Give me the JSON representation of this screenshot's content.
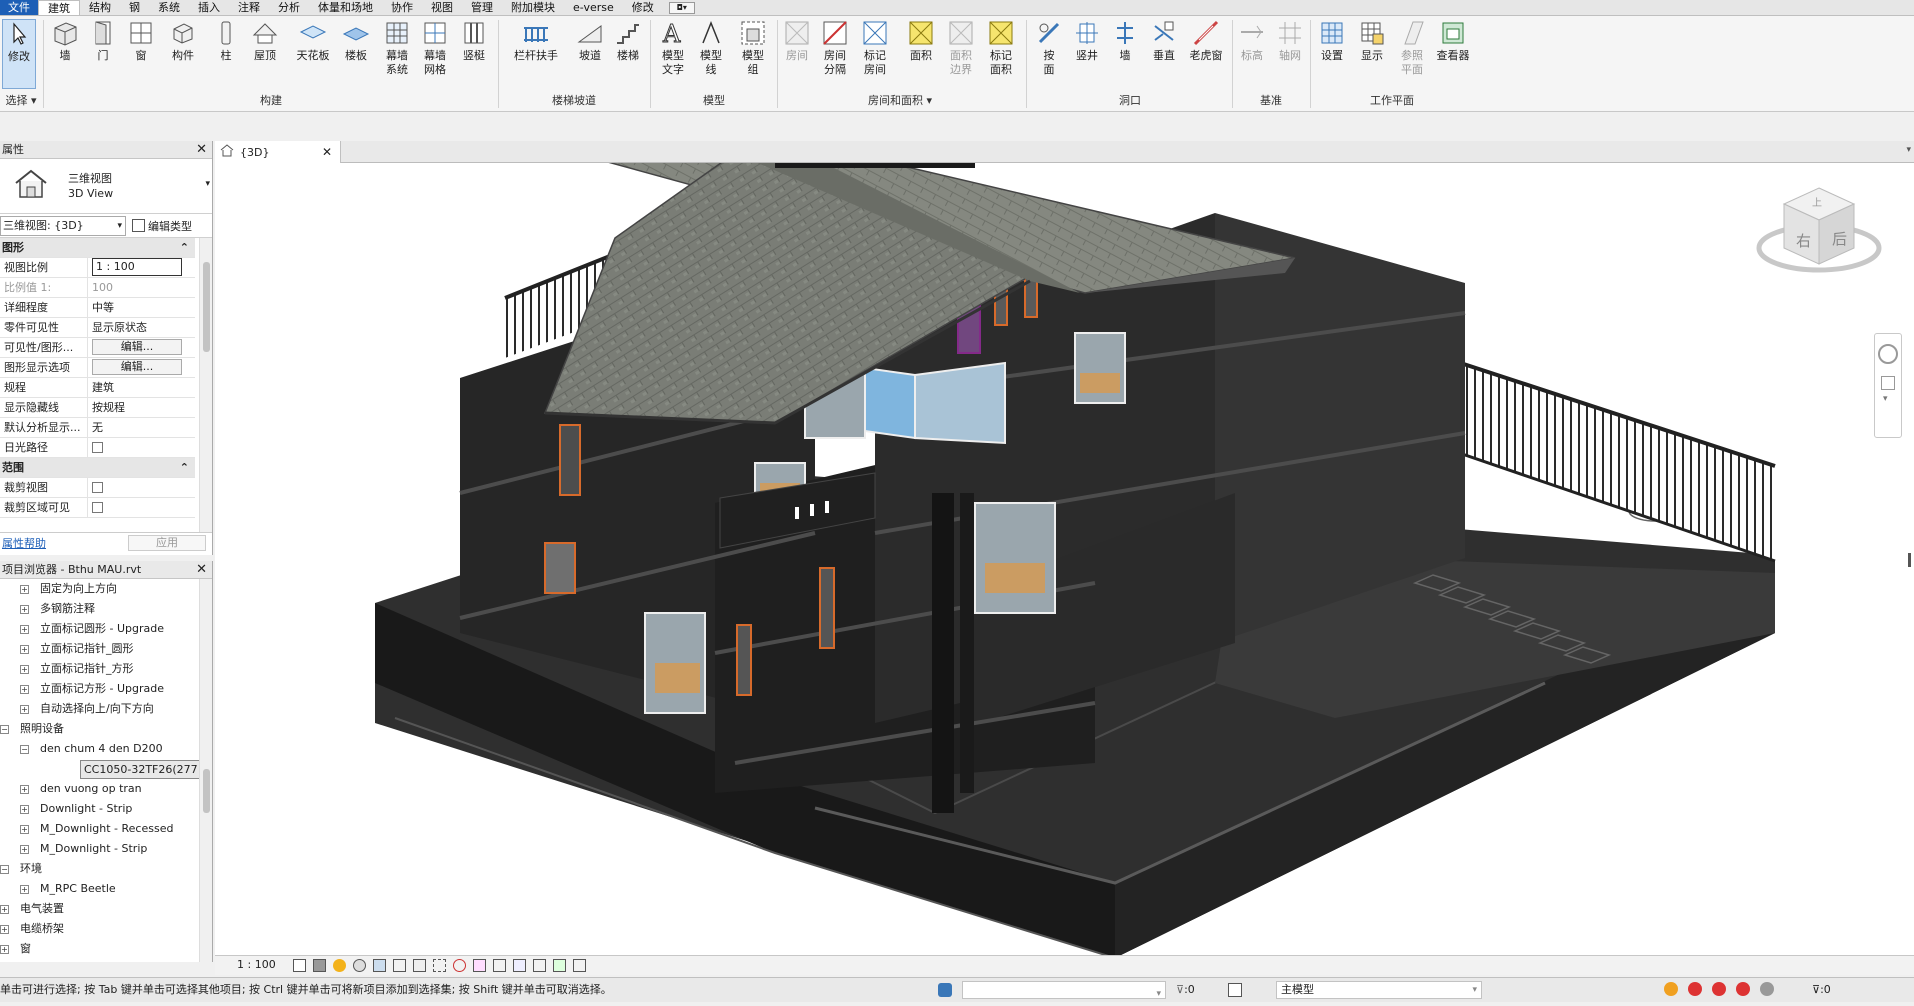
{
  "tabs": [
    "文件",
    "建筑",
    "结构",
    "钢",
    "系统",
    "插入",
    "注释",
    "分析",
    "体量和场地",
    "协作",
    "视图",
    "管理",
    "附加模块",
    "e-verse",
    "修改"
  ],
  "ribbon": {
    "buttons": [
      "修改",
      "墙",
      "门",
      "窗",
      "构件",
      "柱",
      "屋顶",
      "天花板",
      "楼板",
      "幕墙系统",
      "幕墙网格",
      "竖梃",
      "栏杆扶手",
      "坡道",
      "楼梯",
      "模型文字",
      "模型线",
      "模型组",
      "房间",
      "房间分隔",
      "标记房间",
      "面积",
      "面积边界",
      "标记面积",
      "按面",
      "竖井",
      "墙",
      "垂直",
      "老虎窗",
      "标高",
      "轴网",
      "设置",
      "显示",
      "参照平面",
      "查看器"
    ],
    "groups": [
      "选择",
      "构建",
      "楼梯坡道",
      "模型",
      "房间和面积",
      "洞口",
      "基准",
      "工作平面"
    ]
  },
  "properties": {
    "title": "属性",
    "type_name_cn": "三维视图",
    "type_name_en": "3D View",
    "instance_selector": "三维视图: {3D}",
    "edit_type": "编辑类型",
    "cat_graphics": "图形",
    "rows": [
      {
        "k": "视图比例",
        "v": "1 : 100"
      },
      {
        "k": "比例值 1:",
        "v": "100"
      },
      {
        "k": "详细程度",
        "v": "中等"
      },
      {
        "k": "零件可见性",
        "v": "显示原状态"
      },
      {
        "k": "可见性/图形...",
        "v": "编辑..."
      },
      {
        "k": "图形显示选项",
        "v": "编辑..."
      },
      {
        "k": "规程",
        "v": "建筑"
      },
      {
        "k": "显示隐藏线",
        "v": "按规程"
      },
      {
        "k": "默认分析显示...",
        "v": "无"
      },
      {
        "k": "日光路径",
        "v": ""
      }
    ],
    "cat_extents": "范围",
    "rows2": [
      {
        "k": "裁剪视图",
        "v": ""
      },
      {
        "k": "裁剪区域可见",
        "v": ""
      }
    ],
    "help": "属性帮助",
    "apply": "应用"
  },
  "browser": {
    "title": "项目浏览器 - Bthu MAU.rvt",
    "items": [
      {
        "t": "固定为向上方向",
        "lvl": 3
      },
      {
        "t": "多钢筋注释",
        "lvl": 3
      },
      {
        "t": "立面标记圆形 - Upgrade",
        "lvl": 3
      },
      {
        "t": "立面标记指针_圆形",
        "lvl": 3
      },
      {
        "t": "立面标记指针_方形",
        "lvl": 3
      },
      {
        "t": "立面标记方形 - Upgrade",
        "lvl": 3
      },
      {
        "t": "自动选择向上/向下方向",
        "lvl": 3
      },
      {
        "t": "照明设备",
        "lvl": 2,
        "open": true
      },
      {
        "t": "den chum 4 den D200",
        "lvl": 3,
        "open": true
      },
      {
        "t": "CC1050-32TF26(277",
        "lvl": 4,
        "sel": true
      },
      {
        "t": "den vuong op tran",
        "lvl": 3
      },
      {
        "t": "Downlight - Strip",
        "lvl": 3
      },
      {
        "t": "M_Downlight - Recessed",
        "lvl": 3
      },
      {
        "t": "M_Downlight - Strip",
        "lvl": 3
      },
      {
        "t": "环境",
        "lvl": 2,
        "open": true
      },
      {
        "t": "M_RPC Beetle",
        "lvl": 3
      },
      {
        "t": "电气装置",
        "lvl": 1
      },
      {
        "t": "电缆桥架",
        "lvl": 1
      },
      {
        "t": "窗",
        "lvl": 1
      }
    ]
  },
  "view": {
    "tab_label": "{3D}",
    "cube": {
      "top": "上",
      "front": "右",
      "right": "后"
    }
  },
  "viewbar": {
    "scale": "1 : 100"
  },
  "status": {
    "hint": "单击可进行选择; 按 Tab 键并单击可选择其他项目; 按 Ctrl 键并单击可将新项目添加到选择集; 按 Shift 键并单击可取消选择。",
    "sel_count": ":0",
    "model": "主模型",
    "filter_count": ":0"
  }
}
